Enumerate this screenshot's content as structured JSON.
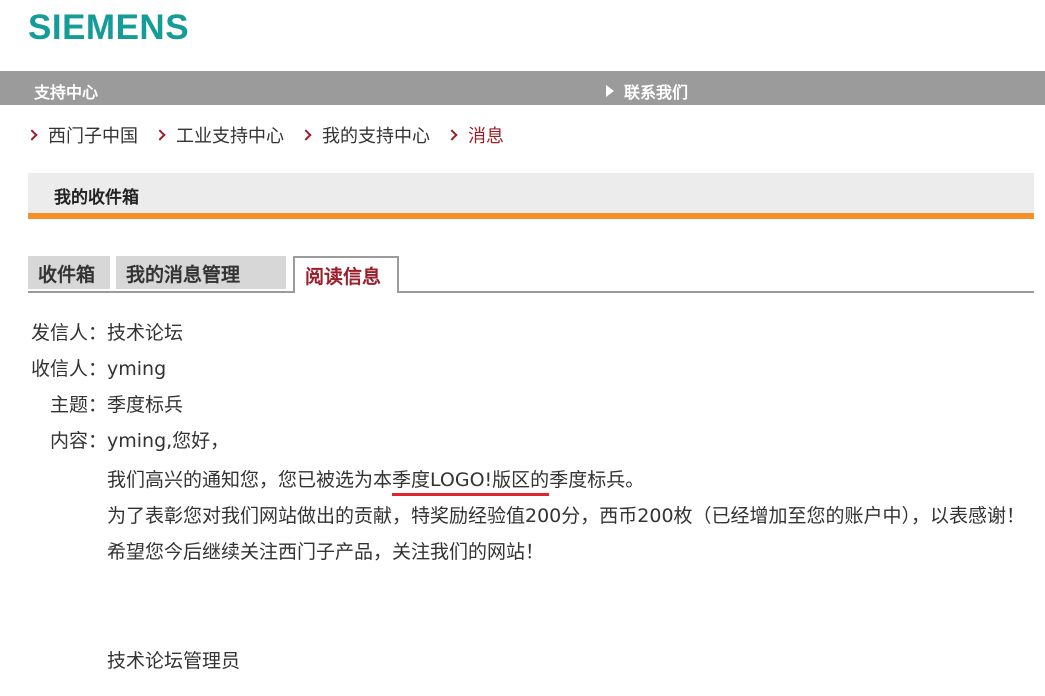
{
  "brand": {
    "name": "SIEMENS",
    "color": "#159c99"
  },
  "topbar": {
    "left_label": "支持中心",
    "right_label": "联系我们",
    "right_icon": "triangle-right-icon"
  },
  "breadcrumb": [
    {
      "label": "西门子中国"
    },
    {
      "label": "工业支持中心"
    },
    {
      "label": "我的支持中心"
    },
    {
      "label": "消息",
      "active": true
    }
  ],
  "section": {
    "title": "我的收件箱"
  },
  "tabs": [
    {
      "label": "收件箱"
    },
    {
      "label": "我的消息管理"
    },
    {
      "label": "阅读信息",
      "active": true
    }
  ],
  "message": {
    "sender_label": "发信人：",
    "sender": "技术论坛",
    "recipient_label": "收信人：",
    "recipient": "yming",
    "subject_label": "主题：",
    "subject": "季度标兵",
    "content_label": "内容：",
    "greeting": "yming,您好，",
    "line1_pre": "我们高兴的通知您，您已被选为本",
    "line1_underlined": "季度LOGO!版区的",
    "line1_post": "季度标兵。",
    "line2": "为了表彰您对我们网站做出的贡献，特奖励经验值200分，西币200枚（已经增加至您的账户中），以表感谢！",
    "line3": "希望您今后继续关注西门子产品，关注我们的网站！",
    "signature": "技术论坛管理员"
  },
  "colors": {
    "accent": "#f59028",
    "crumb": "#9a1f2a",
    "underline": "#e0232e",
    "bar": "#9b9b9b"
  }
}
